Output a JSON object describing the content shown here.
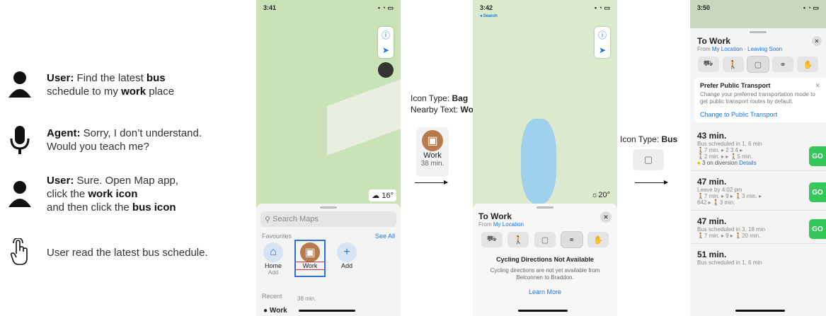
{
  "dialog": [
    {
      "speaker": "User:",
      "parts": [
        " Find the latest ",
        "bus",
        " schedule to my ",
        "work",
        " place"
      ]
    },
    {
      "speaker": "Agent:",
      "lines": [
        "Sorry, I don’t understand.",
        "Would you teach me?"
      ]
    },
    {
      "speaker": "User:",
      "lines": [
        "Sure. Open Map app,"
      ],
      "l2": [
        "click the ",
        "work icon"
      ],
      "l3": [
        "and then click the ",
        "bus icon"
      ]
    },
    {
      "text": "User read the latest bus schedule."
    }
  ],
  "phone1": {
    "time": "3:41",
    "temp": "16°",
    "search_placeholder": "Search Maps",
    "favourites_label": "Favourites",
    "see_all": "See All",
    "favs": [
      {
        "name": "Home",
        "sub": "Add"
      },
      {
        "name": "Work",
        "sub": "38 min."
      },
      {
        "name": "Add",
        "sub": ""
      }
    ],
    "recent_label": "Recent",
    "recent_item": "Work"
  },
  "annot1": {
    "type_label": "Icon Type: ",
    "type_value": "Bag",
    "near_label": "Nearby Text: ",
    "near_value": "Work",
    "card_name": "Work",
    "card_sub": "38 min."
  },
  "phone2": {
    "time": "3:42",
    "back": "◂ Search",
    "temp": "20°",
    "title": "To Work",
    "from_label": "From ",
    "from_link": "My Location",
    "msg_title": "Cycling Directions Not Available",
    "msg_body": "Cycling directions are not yet available from Belconnen to Braddon.",
    "learn_more": "Learn More"
  },
  "annot2": {
    "type_label": "Icon Type: ",
    "type_value": "Bus"
  },
  "phone3": {
    "time": "3:50",
    "title": "To Work",
    "from_label": "From ",
    "from_link": "My Location · Leaving Soon",
    "banner_title": "Prefer Public Transport",
    "banner_body": "Change your preferred transportation mode to get public transport routes by default.",
    "banner_link": "Change to Public Transport",
    "go": "GO",
    "routes": [
      {
        "time": "43 min.",
        "sub": "Bus scheduled in 1, 6 min",
        "l1": "🚶7 min. ▸  2  3  4  ▸",
        "l2": "🚶2 min. ▸  ▸ 🚶5 min.",
        "extra": "3 on diversion",
        "extra_link": "Details"
      },
      {
        "time": "47 min.",
        "sub": "Leave by 4:02 pm",
        "l1": "🚶7 min. ▸  9  ▸ 🚶3 min. ▸",
        "l2": "642  ▸ 🚶3 min."
      },
      {
        "time": "47 min.",
        "sub": "Bus scheduled in 3, 18 min",
        "l1": "🚶7 min. ▸  9  ▸ 🚶20 min."
      },
      {
        "time": "51 min.",
        "sub": "Bus scheduled in 1, 6 min"
      }
    ]
  }
}
